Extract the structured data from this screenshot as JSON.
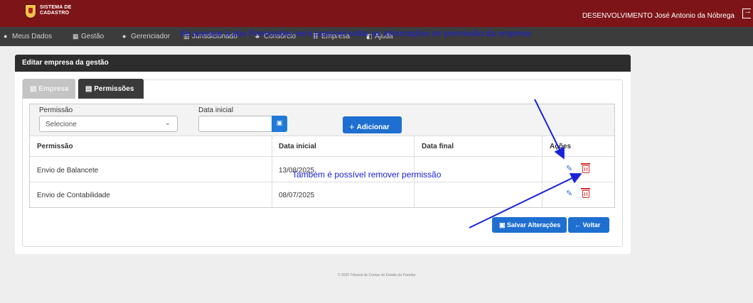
{
  "header": {
    "logo_text_line1": "SISTEMA DE",
    "logo_text_line2": "CADASTRO",
    "user": "DESENVOLVIMENTO José Antonio da Nóbrega"
  },
  "nav": {
    "items": [
      {
        "label": "Meus Dados",
        "icon": "user-icon"
      },
      {
        "label": "Gestão",
        "icon": "calendar-icon"
      },
      {
        "label": "Gerenciador",
        "icon": "user-icon"
      },
      {
        "label": "Jurisdicionado",
        "icon": "institution-icon"
      },
      {
        "label": "Consórcio",
        "icon": "sitemap-icon"
      },
      {
        "label": "Empresa",
        "icon": "list-icon"
      },
      {
        "label": "Ajuda",
        "icon": "book-icon"
      }
    ]
  },
  "page": {
    "title": "Editar empresa da gestão"
  },
  "tabs": {
    "empresa": "Empresa",
    "permissoes": "Permissões"
  },
  "annotations": {
    "top": "Ao acessar a aba Permissões será possível editar as informações de permissão da empresa",
    "bottom": "Também é possível remover permissão"
  },
  "form": {
    "permissao_label": "Permissão",
    "permissao_value": "Selecione",
    "data_inicial_label": "Data inicial",
    "add_label": "Adicionar"
  },
  "table": {
    "headers": [
      "Permissão",
      "Data inicial",
      "Data final",
      "Ações"
    ],
    "rows": [
      {
        "permissao": "Envio de Balancete",
        "data_inicial": "13/08/2025",
        "data_final": ""
      },
      {
        "permissao": "Envio de Contabilidade",
        "data_inicial": "08/07/2025",
        "data_final": ""
      }
    ]
  },
  "actions": {
    "save_label": "Salvar Alterações",
    "back_label": "Voltar"
  },
  "footer": {
    "text": "© 2025 Tribunal de Contas do Estado da Paraíba"
  },
  "colors": {
    "topbar": "#7d1518",
    "navbar": "#3c3c3c",
    "primary": "#1e6fd0",
    "annotation": "#1a22d9",
    "danger": "#d62b2b"
  }
}
